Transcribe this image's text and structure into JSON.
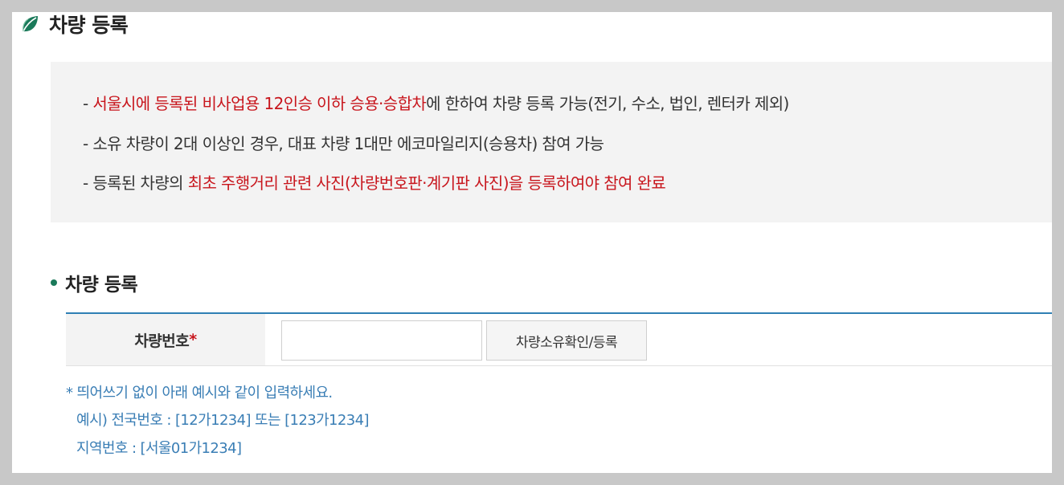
{
  "header": {
    "title": "차량 등록"
  },
  "notice": {
    "line1": {
      "prefix": "- ",
      "highlight": "서울시에 등록된 비사업용 12인승 이하 승용·승합차",
      "suffix": "에 한하여 차량 등록 가능(전기, 수소, 법인, 렌터카 제외)"
    },
    "line2": {
      "text": "- 소유 차량이 2대 이상인 경우, 대표 차량 1대만 에코마일리지(승용차) 참여 가능"
    },
    "line3": {
      "prefix": "- 등록된 차량의 ",
      "highlight": "최초 주행거리 관련 사진(차량번호판·계기판 사진)을 등록하여야 참여 완료",
      "suffix": ""
    }
  },
  "section": {
    "title": "차량 등록"
  },
  "form": {
    "plate_label": "차량번호",
    "required_mark": "*",
    "plate_value": "",
    "plate_placeholder": "",
    "verify_button": "차량소유확인/등록"
  },
  "help": {
    "line1": "* 띄어쓰기 없이 아래 예시와 같이 입력하세요.",
    "line2": "예시) 전국번호 : [12가1234] 또는 [123가1234]",
    "line3": "지역번호 : [서울01가1234]"
  },
  "colors": {
    "accent_red": "#c8161d",
    "accent_blue": "#2f7fb4",
    "help_blue": "#3a7eb5",
    "leaf_green": "#1b7a5a"
  },
  "icons": {
    "header_icon": "leaf-icon",
    "section_bullet": "bullet-dot"
  }
}
